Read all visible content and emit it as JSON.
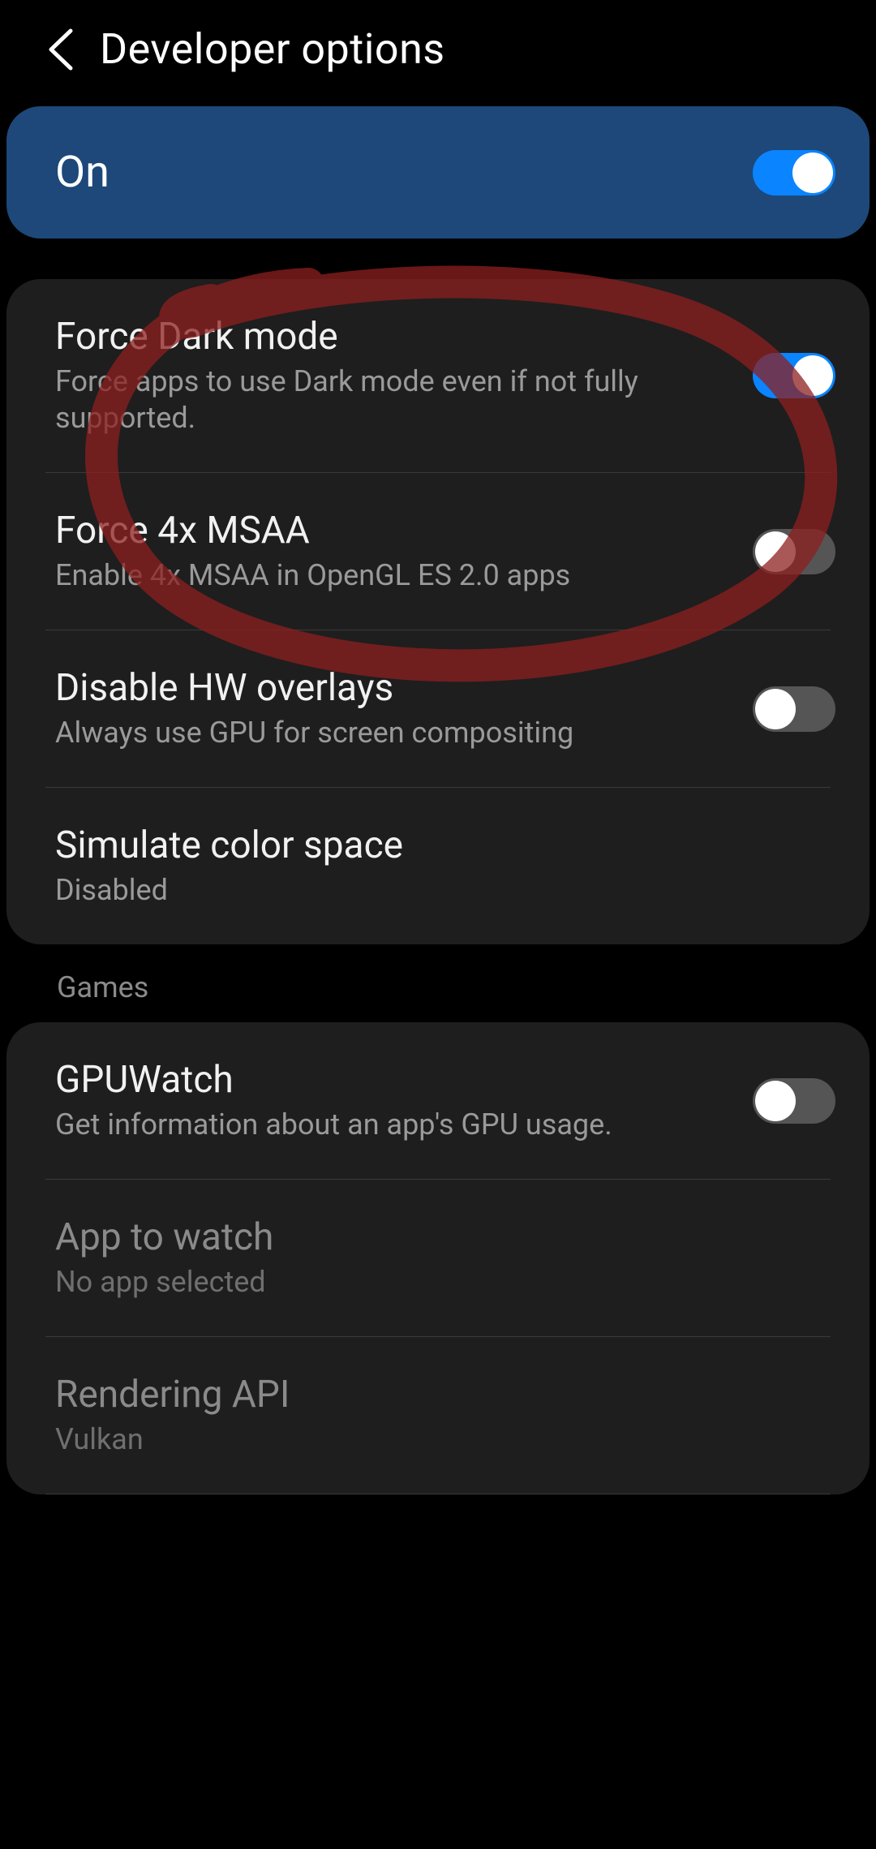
{
  "header": {
    "title": "Developer options"
  },
  "master": {
    "label": "On",
    "checked": true
  },
  "group1": {
    "items": [
      {
        "title": "Force Dark mode",
        "sub": "Force apps to use Dark mode even if not fully supported.",
        "toggle": true,
        "checked": true
      },
      {
        "title": "Force 4x MSAA",
        "sub": "Enable 4x MSAA in OpenGL ES 2.0 apps",
        "toggle": true,
        "checked": false
      },
      {
        "title": "Disable HW overlays",
        "sub": "Always use GPU for screen compositing",
        "toggle": true,
        "checked": false
      },
      {
        "title": "Simulate color space",
        "sub": "Disabled",
        "toggle": false
      }
    ]
  },
  "section_games": "Games",
  "group2": {
    "items": [
      {
        "title": "GPUWatch",
        "sub": "Get information about an app's GPU usage.",
        "toggle": true,
        "checked": false,
        "dim": false
      },
      {
        "title": "App to watch",
        "sub": "No app selected",
        "toggle": false,
        "dim": true
      },
      {
        "title": "Rendering API",
        "sub": "Vulkan",
        "toggle": false,
        "dim": true
      }
    ]
  }
}
